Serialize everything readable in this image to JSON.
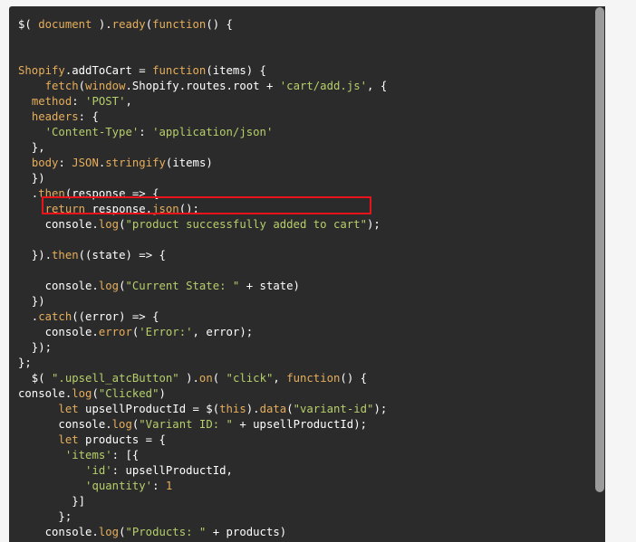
{
  "code": {
    "lines": [
      [
        {
          "t": "$( ",
          "c": "plain"
        },
        {
          "t": "document",
          "c": "kw"
        },
        {
          "t": " ).",
          "c": "plain"
        },
        {
          "t": "ready",
          "c": "fn"
        },
        {
          "t": "(",
          "c": "plain"
        },
        {
          "t": "function",
          "c": "kw"
        },
        {
          "t": "() {",
          "c": "plain"
        }
      ],
      [],
      [],
      [
        {
          "t": "Shopify",
          "c": "kw"
        },
        {
          "t": ".addToCart = ",
          "c": "plain"
        },
        {
          "t": "function",
          "c": "kw"
        },
        {
          "t": "(items) {",
          "c": "plain"
        }
      ],
      [
        {
          "t": "    ",
          "c": "plain"
        },
        {
          "t": "fetch",
          "c": "fn"
        },
        {
          "t": "(",
          "c": "plain"
        },
        {
          "t": "window",
          "c": "kw"
        },
        {
          "t": ".Shopify.routes.root + ",
          "c": "plain"
        },
        {
          "t": "'cart/add.js'",
          "c": "str"
        },
        {
          "t": ", {",
          "c": "plain"
        }
      ],
      [
        {
          "t": "  ",
          "c": "plain"
        },
        {
          "t": "method",
          "c": "prop"
        },
        {
          "t": ": ",
          "c": "plain"
        },
        {
          "t": "'POST'",
          "c": "str"
        },
        {
          "t": ",",
          "c": "plain"
        }
      ],
      [
        {
          "t": "  ",
          "c": "plain"
        },
        {
          "t": "headers",
          "c": "prop"
        },
        {
          "t": ": {",
          "c": "plain"
        }
      ],
      [
        {
          "t": "    ",
          "c": "plain"
        },
        {
          "t": "'Content-Type'",
          "c": "str"
        },
        {
          "t": ": ",
          "c": "plain"
        },
        {
          "t": "'application/json'",
          "c": "str"
        }
      ],
      [
        {
          "t": "  },",
          "c": "plain"
        }
      ],
      [
        {
          "t": "  ",
          "c": "plain"
        },
        {
          "t": "body",
          "c": "prop"
        },
        {
          "t": ": ",
          "c": "plain"
        },
        {
          "t": "JSON",
          "c": "kw"
        },
        {
          "t": ".",
          "c": "plain"
        },
        {
          "t": "stringify",
          "c": "fn"
        },
        {
          "t": "(items)",
          "c": "plain"
        }
      ],
      [
        {
          "t": "  })",
          "c": "plain"
        }
      ],
      [
        {
          "t": "  .",
          "c": "plain"
        },
        {
          "t": "then",
          "c": "fn"
        },
        {
          "t": "(response => {",
          "c": "plain"
        }
      ],
      [
        {
          "t": "    ",
          "c": "plain"
        },
        {
          "t": "return",
          "c": "kw"
        },
        {
          "t": " response.",
          "c": "plain"
        },
        {
          "t": "json",
          "c": "fn"
        },
        {
          "t": "();",
          "c": "plain"
        }
      ],
      [
        {
          "t": "    console.",
          "c": "plain"
        },
        {
          "t": "log",
          "c": "fn"
        },
        {
          "t": "(",
          "c": "plain"
        },
        {
          "t": "\"product successfully added to cart\"",
          "c": "str"
        },
        {
          "t": ");",
          "c": "plain"
        }
      ],
      [],
      [
        {
          "t": "  }).",
          "c": "plain"
        },
        {
          "t": "then",
          "c": "fn"
        },
        {
          "t": "((state) => {",
          "c": "plain"
        }
      ],
      [],
      [
        {
          "t": "    console.",
          "c": "plain"
        },
        {
          "t": "log",
          "c": "fn"
        },
        {
          "t": "(",
          "c": "plain"
        },
        {
          "t": "\"Current State: \"",
          "c": "str"
        },
        {
          "t": " + state)",
          "c": "plain"
        }
      ],
      [
        {
          "t": "  })",
          "c": "plain"
        }
      ],
      [
        {
          "t": "  .",
          "c": "plain"
        },
        {
          "t": "catch",
          "c": "fn"
        },
        {
          "t": "((error) => {",
          "c": "plain"
        }
      ],
      [
        {
          "t": "    console.",
          "c": "plain"
        },
        {
          "t": "error",
          "c": "fn"
        },
        {
          "t": "(",
          "c": "plain"
        },
        {
          "t": "'Error:'",
          "c": "str"
        },
        {
          "t": ", error);",
          "c": "plain"
        }
      ],
      [
        {
          "t": "  });",
          "c": "plain"
        }
      ],
      [
        {
          "t": "};",
          "c": "plain"
        }
      ],
      [
        {
          "t": "  $( ",
          "c": "plain"
        },
        {
          "t": "\".upsell_atcButton\"",
          "c": "str"
        },
        {
          "t": " ).",
          "c": "plain"
        },
        {
          "t": "on",
          "c": "fn"
        },
        {
          "t": "( ",
          "c": "plain"
        },
        {
          "t": "\"click\"",
          "c": "str"
        },
        {
          "t": ", ",
          "c": "plain"
        },
        {
          "t": "function",
          "c": "kw"
        },
        {
          "t": "() {",
          "c": "plain"
        }
      ],
      [
        {
          "t": "console.",
          "c": "plain"
        },
        {
          "t": "log",
          "c": "fn"
        },
        {
          "t": "(",
          "c": "plain"
        },
        {
          "t": "\"Clicked\"",
          "c": "str"
        },
        {
          "t": ")",
          "c": "plain"
        }
      ],
      [
        {
          "t": "      ",
          "c": "plain"
        },
        {
          "t": "let",
          "c": "kw"
        },
        {
          "t": " upsellProductId = $(",
          "c": "plain"
        },
        {
          "t": "this",
          "c": "kw"
        },
        {
          "t": ").",
          "c": "plain"
        },
        {
          "t": "data",
          "c": "fn"
        },
        {
          "t": "(",
          "c": "plain"
        },
        {
          "t": "\"variant-id\"",
          "c": "str"
        },
        {
          "t": ");",
          "c": "plain"
        }
      ],
      [
        {
          "t": "      console.",
          "c": "plain"
        },
        {
          "t": "log",
          "c": "fn"
        },
        {
          "t": "(",
          "c": "plain"
        },
        {
          "t": "\"Variant ID: \"",
          "c": "str"
        },
        {
          "t": " + upsellProductId);",
          "c": "plain"
        }
      ],
      [
        {
          "t": "      ",
          "c": "plain"
        },
        {
          "t": "let",
          "c": "kw"
        },
        {
          "t": " products = {",
          "c": "plain"
        }
      ],
      [
        {
          "t": "       ",
          "c": "plain"
        },
        {
          "t": "'items'",
          "c": "str"
        },
        {
          "t": ": [{",
          "c": "plain"
        }
      ],
      [
        {
          "t": "          ",
          "c": "plain"
        },
        {
          "t": "'id'",
          "c": "str"
        },
        {
          "t": ": upsellProductId,",
          "c": "plain"
        }
      ],
      [
        {
          "t": "          ",
          "c": "plain"
        },
        {
          "t": "'quantity'",
          "c": "str"
        },
        {
          "t": ": ",
          "c": "plain"
        },
        {
          "t": "1",
          "c": "num"
        }
      ],
      [
        {
          "t": "        }]",
          "c": "plain"
        }
      ],
      [
        {
          "t": "      };",
          "c": "plain"
        }
      ],
      [
        {
          "t": "    console.",
          "c": "plain"
        },
        {
          "t": "log",
          "c": "fn"
        },
        {
          "t": "(",
          "c": "plain"
        },
        {
          "t": "\"Products: \"",
          "c": "str"
        },
        {
          "t": " + products)",
          "c": "plain"
        }
      ]
    ]
  },
  "colors": {
    "background": "#2b2b2b",
    "highlight_box": "#e8131b",
    "scrollbar_thumb": "#9b9b9b"
  }
}
